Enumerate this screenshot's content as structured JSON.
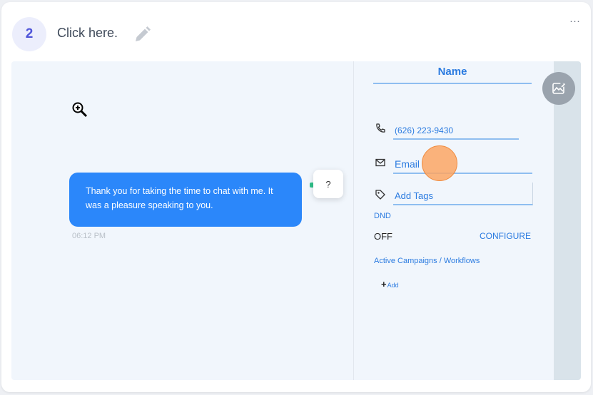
{
  "step": {
    "number": "2",
    "instruction": "Click here."
  },
  "menu": {
    "more_icon": "ellipsis-icon",
    "more_label": "···"
  },
  "chat": {
    "message_line1": "Thank you for taking the time to chat with me. It",
    "message_line2": "was a pleasure speaking to you.",
    "timestamp": "06:12 PM",
    "help_label": "?"
  },
  "contact_panel": {
    "name": "Name",
    "phone": "(626) 223-9430",
    "email": "Email",
    "tags": "Add Tags",
    "dnd_label": "DND",
    "dnd_value": "OFF",
    "configure": "CONFIGURE",
    "campaigns_label": "Active Campaigns / Workflows",
    "add_label": "Add"
  },
  "colors": {
    "accent": "#2b7be0",
    "bubble": "#2b87fa",
    "click_marker": "#fca664",
    "step_badge": "#4f55d9"
  }
}
